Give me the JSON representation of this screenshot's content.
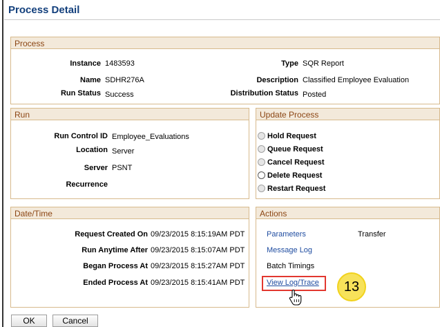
{
  "page": {
    "title": "Process Detail"
  },
  "process": {
    "header": "Process",
    "instance_label": "Instance",
    "instance_value": "1483593",
    "name_label": "Name",
    "name_value": "SDHR276A",
    "run_status_label": "Run Status",
    "run_status_value": "Success",
    "type_label": "Type",
    "type_value": "SQR Report",
    "description_label": "Description",
    "description_value": "Classified Employee Evaluation",
    "distribution_status_label": "Distribution Status",
    "distribution_status_value": "Posted"
  },
  "run": {
    "header": "Run",
    "run_control_label": "Run Control ID",
    "run_control_value": "Employee_Evaluations",
    "location_label": "Location",
    "location_value": "Server",
    "server_label": "Server",
    "server_value": "PSNT",
    "recurrence_label": "Recurrence",
    "recurrence_value": ""
  },
  "update_process": {
    "header": "Update Process",
    "options": [
      "Hold Request",
      "Queue Request",
      "Cancel Request",
      "Delete Request",
      "Restart Request"
    ]
  },
  "datetime": {
    "header": "Date/Time",
    "request_created_label": "Request Created On",
    "request_created_value": "09/23/2015  8:15:19AM PDT",
    "run_anytime_label": "Run Anytime After",
    "run_anytime_value": "09/23/2015  8:15:07AM PDT",
    "began_label": "Began Process At",
    "began_value": "09/23/2015  8:15:27AM PDT",
    "ended_label": "Ended Process At",
    "ended_value": "09/23/2015  8:15:41AM PDT"
  },
  "actions": {
    "header": "Actions",
    "parameters": "Parameters",
    "transfer": "Transfer",
    "message_log": "Message Log",
    "batch_timings": "Batch Timings",
    "view_log_trace": "View Log/Trace"
  },
  "callout": {
    "step": "13"
  },
  "buttons": {
    "ok": "OK",
    "cancel": "Cancel"
  },
  "colors": {
    "title": "#123f7c",
    "header_bg": "#f3e9da",
    "header_text": "#8b4513",
    "link": "#1f4ca0",
    "highlight": "#e2372f",
    "badge": "#f7e25a"
  }
}
